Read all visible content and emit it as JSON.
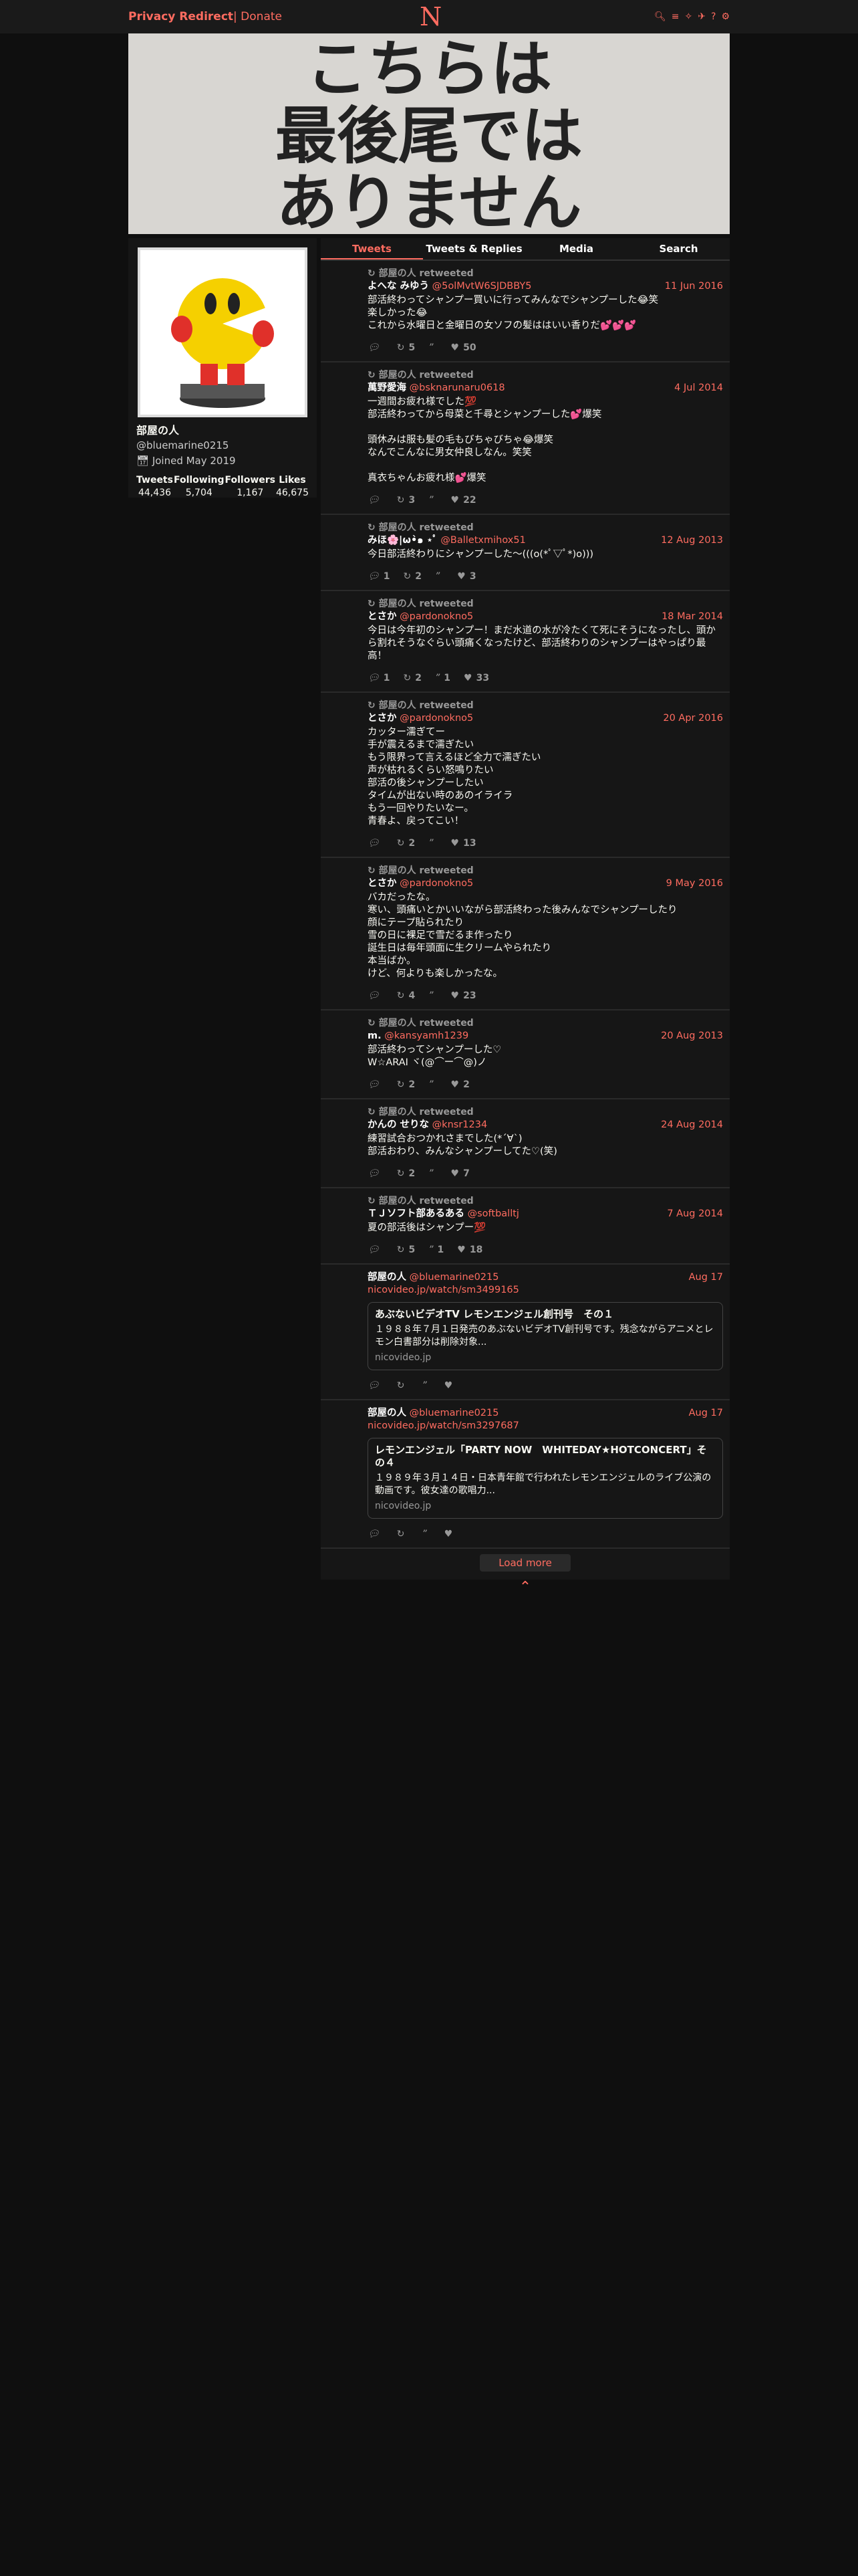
{
  "nav": {
    "brand": "Privacy Redirect",
    "donate": "| Donate",
    "logo": "N",
    "icons": [
      "search-icon",
      "rss-icon",
      "twitter-icon",
      "birdsite-icon",
      "help-icon",
      "settings-icon"
    ]
  },
  "banner": {
    "text": "こちらは\n最後尾では\nありません"
  },
  "profile": {
    "name": "部屋の人",
    "username": "@bluemarine0215",
    "joined": "Joined May 2019",
    "stats": [
      {
        "label": "Tweets",
        "value": "44,436"
      },
      {
        "label": "Following",
        "value": "5,704"
      },
      {
        "label": "Followers",
        "value": "1,167"
      },
      {
        "label": "Likes",
        "value": "46,675"
      }
    ]
  },
  "tabs": [
    "Tweets",
    "Tweets & Replies",
    "Media",
    "Search"
  ],
  "tweets": [
    {
      "rt": "部屋の人 retweeted",
      "name": "よへな みゆう",
      "user": "@5olMvtW6SJDBBY5",
      "date": "11 Jun 2016",
      "text": "部活終わってシャンプー買いに行ってみんなでシャンプーした😂笑\n楽しかった😂\nこれから水曜日と金曜日の女ソフの髪ははいい香りだ💕💕💕",
      "replies": "",
      "rts": "5",
      "quotes": "",
      "likes": "50"
    },
    {
      "rt": "部屋の人 retweeted",
      "name": "萬野愛海",
      "user": "@bsknarunaru0618",
      "date": "4 Jul 2014",
      "text": "一週間お疲れ様でした💯\n部活終わってから母菜と千尋とシャンプーした💕爆笑\n\n頭休みは服も髪の毛もびちゃびちゃ😂爆笑\nなんでこんなに男女仲良しなん。笑笑\n\n真衣ちゃんお疲れ様💕爆笑",
      "replies": "",
      "rts": "3",
      "quotes": "",
      "likes": "22"
    },
    {
      "rt": "部屋の人 retweeted",
      "name": "みほ🌸|ω•̀๑ ⋆ﾟ",
      "user": "@Balletxmihox51",
      "date": "12 Aug 2013",
      "text": "今日部活終わりにシャンプーした〜(((o(*ﾟ▽ﾟ*)o)))",
      "replies": "1",
      "rts": "2",
      "quotes": "",
      "likes": "3"
    },
    {
      "rt": "部屋の人 retweeted",
      "name": "とさか",
      "user": "@pardonokno5",
      "date": "18 Mar 2014",
      "text": "今日は今年初のシャンプー！まだ水道の水が冷たくて死にそうになったし、頭から割れそうなぐらい頭痛くなったけど、部活終わりのシャンプーはやっぱり最高！",
      "replies": "1",
      "rts": "2",
      "quotes": "1",
      "likes": "33"
    },
    {
      "rt": "部屋の人 retweeted",
      "name": "とさか",
      "user": "@pardonokno5",
      "date": "20 Apr 2016",
      "text": "カッター濡ぎてー\n手が震えるまで濡ぎたい\nもう限界って言えるほど全力で濡ぎたい\n声が枯れるくらい怒鳴りたい\n部活の後シャンプーしたい\nタイムが出ない時のあのイライラ\nもう一回やりたいなー。\n青春よ、戻ってこい！",
      "replies": "",
      "rts": "2",
      "quotes": "",
      "likes": "13"
    },
    {
      "rt": "部屋の人 retweeted",
      "name": "とさか",
      "user": "@pardonokno5",
      "date": "9 May 2016",
      "text": "バカだったな。\n寒い、頭痛いとかいいながら部活終わった後みんなでシャンプーしたり\n顔にテープ貼られたり\n雪の日に裸足で雪だるま作ったり\n誕生日は毎年頭面に生クリームやられたり\n本当ばか。\nけど、何よりも楽しかったな。",
      "replies": "",
      "rts": "4",
      "quotes": "",
      "likes": "23"
    },
    {
      "rt": "部屋の人 retweeted",
      "name": "m.",
      "user": "@kansyamh1239",
      "date": "20 Aug 2013",
      "text": "部活終わってシャンプーした♡\nW☆ARAI ヾ(@⌒ー⌒@)ノ",
      "replies": "",
      "rts": "2",
      "quotes": "",
      "likes": "2"
    },
    {
      "rt": "部屋の人 retweeted",
      "name": "かんの せりな",
      "user": "@knsr1234",
      "date": "24 Aug 2014",
      "text": "練習試合おつかれさまでした(*´∀`)\n部活おわり、みんなシャンプーしてた♡(笑)",
      "replies": "",
      "rts": "2",
      "quotes": "",
      "likes": "7"
    },
    {
      "rt": "部屋の人 retweeted",
      "name": "ＴＪソフト部あるある",
      "user": "@softballtj",
      "date": "7 Aug 2014",
      "text": "夏の部活後はシャンプー💯",
      "replies": "",
      "rts": "5",
      "quotes": "1",
      "likes": "18"
    },
    {
      "rt": "",
      "name": "部屋の人",
      "user": "@bluemarine0215",
      "date": "Aug 17",
      "link": "nicovideo.jp/watch/sm3499165",
      "card": {
        "title": "あぶないビデオTV レモンエンジェル創刊号　その１",
        "desc": "１９８８年７月１日発売のあぶないビデオTV創刊号です。残念ながらアニメとレモン白書部分は削除対象...",
        "site": "nicovideo.jp"
      },
      "replies": "",
      "rts": "",
      "quotes": "",
      "likes": ""
    },
    {
      "rt": "",
      "name": "部屋の人",
      "user": "@bluemarine0215",
      "date": "Aug 17",
      "link": "nicovideo.jp/watch/sm3297687",
      "card": {
        "title": "レモンエンジェル「PARTY NOW　WHITEDAY★HOTCONCERT」その４",
        "desc": "１９８９年３月１４日・日本青年館で行われたレモンエンジェルのライブ公演の動画です。彼女達の歌唱力...",
        "site": "nicovideo.jp"
      },
      "replies": "",
      "rts": "",
      "quotes": "",
      "likes": ""
    }
  ],
  "load_more": "Load more",
  "top_icon": "arrow-up-icon"
}
